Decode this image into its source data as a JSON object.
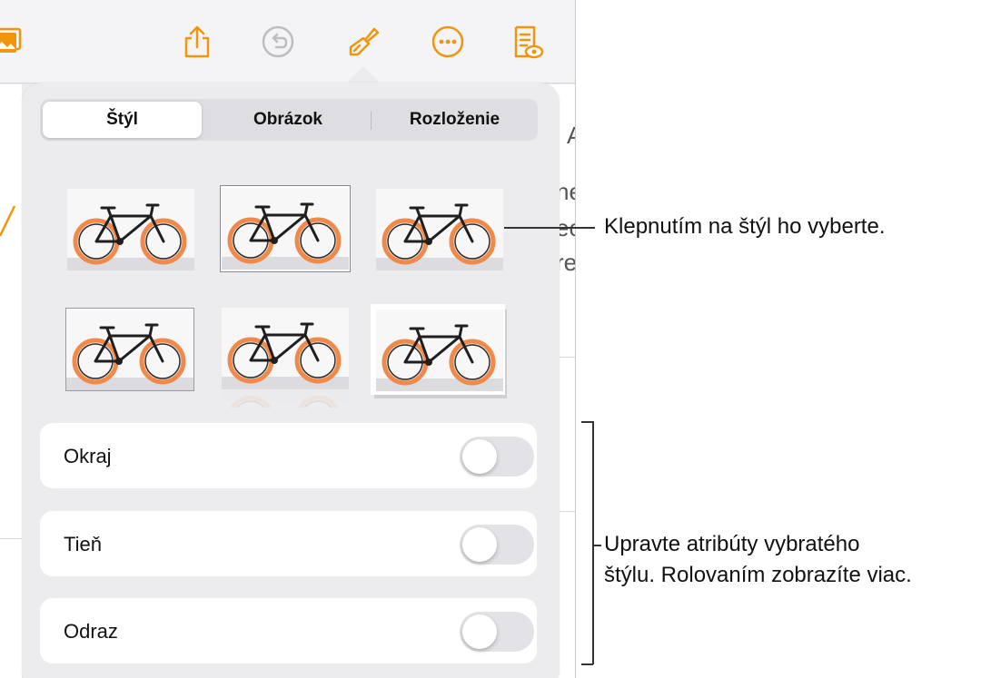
{
  "toolbar": {
    "icons": [
      "media-icon",
      "share-icon",
      "undo-icon",
      "format-brush-icon",
      "more-icon",
      "reading-view-icon"
    ],
    "accent_color": "#f0950e"
  },
  "popover": {
    "tabs": [
      {
        "label": "Štýl",
        "selected": true
      },
      {
        "label": "Obrázok",
        "selected": false
      },
      {
        "label": "Rozloženie",
        "selected": false
      }
    ],
    "style_presets": [
      "bike-plain",
      "bike-thin-border",
      "bike-soft-edge",
      "bike-gray-frame",
      "bike-reflection",
      "bike-photo-shadow"
    ],
    "rows": [
      {
        "label": "Okraj",
        "on": false
      },
      {
        "label": "Tieň",
        "on": false
      },
      {
        "label": "Odraz",
        "on": false
      }
    ]
  },
  "background_text": {
    "frag_a": "A",
    "frag_ne": "ne",
    "frag_ec": "ec",
    "frag_re": "re"
  },
  "callouts": {
    "select_style": "Klepnutím na štýl ho vyberte.",
    "adjust_line1": "Upravte atribúty vybratého",
    "adjust_line2": "štýlu. Rolovaním zobrazíte viac."
  }
}
